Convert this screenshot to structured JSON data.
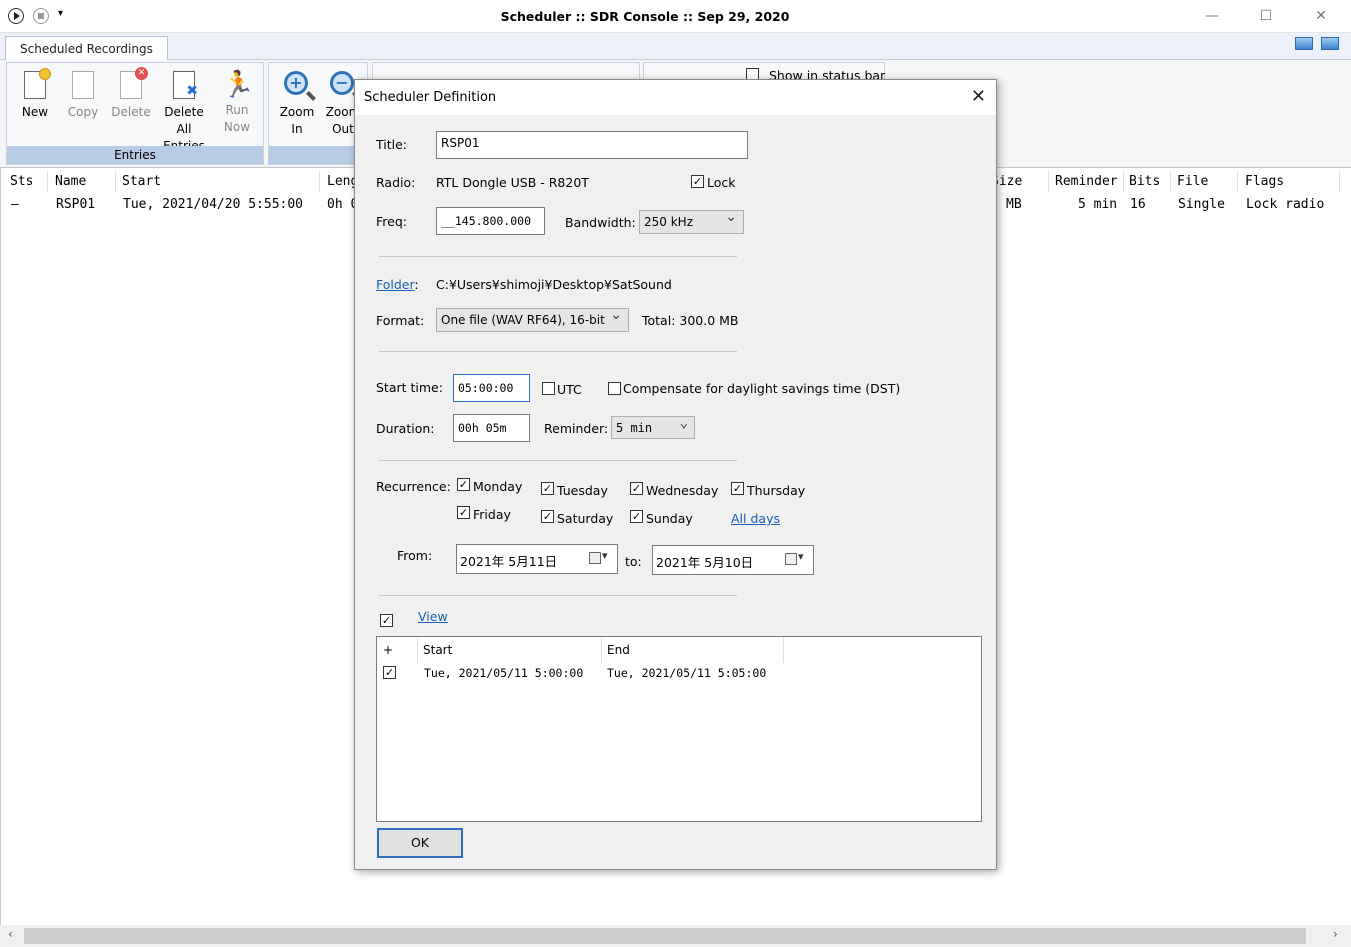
{
  "window": {
    "title": "Scheduler :: SDR Console :: Sep 29, 2020",
    "minimize": "—",
    "maximize": "☐",
    "close": "✕"
  },
  "tabs": [
    {
      "label": "Scheduled Recordings"
    }
  ],
  "ribbon": {
    "entries_group": "Entries",
    "buttons": {
      "new": [
        "New",
        ""
      ],
      "copy": [
        "Copy",
        ""
      ],
      "delete": [
        "Delete",
        ""
      ],
      "delete_all": [
        "Delete All",
        "Entries"
      ],
      "run_now": [
        "Run",
        "Now"
      ],
      "zoom_in": [
        "Zoom",
        "In"
      ],
      "zoom_out": [
        "Zoom",
        "Out"
      ]
    },
    "show_in_status_bar": "Show in status bar"
  },
  "list": {
    "columns": [
      "Sts",
      "Name",
      "Start",
      "Leng",
      "Size",
      "Reminder",
      "Bits",
      "File",
      "Flags"
    ],
    "rows": [
      {
        "sts": "—",
        "name": "RSP01",
        "start": "Tue, 2021/04/20 5:55:00",
        "length": "0h 0",
        "size": "MB",
        "reminder": "5 min",
        "bits": "16",
        "file": "Single",
        "flags": "Lock radio"
      }
    ]
  },
  "dialog": {
    "title": "Scheduler Definition",
    "close": "✕",
    "title_label": "Title:",
    "title_value": "RSP01",
    "radio_label": "Radio:",
    "radio_value": "RTL Dongle USB - R820T",
    "lock_label": "Lock",
    "lock_checked": true,
    "freq_label": "Freq:",
    "freq_value": "__145.800.000",
    "bandwidth_label": "Bandwidth:",
    "bandwidth_value": "250 kHz",
    "folder_label": "Folder",
    "folder_colon": ":",
    "folder_value": "C:¥Users¥shimoji¥Desktop¥SatSound",
    "format_label": "Format:",
    "format_value": "One file (WAV RF64), 16-bit",
    "total_label": "Total: 300.0 MB",
    "start_time_label": "Start time:",
    "start_time_value": "05:00:00",
    "utc_label": "UTC",
    "dst_label": "Compensate for daylight savings time (DST)",
    "duration_label": "Duration:",
    "duration_value": "00h 05m",
    "reminder_label": "Reminder:",
    "reminder_value": "5 min",
    "recurrence_label": "Recurrence:",
    "days": {
      "monday": "Monday",
      "tuesday": "Tuesday",
      "wednesday": "Wednesday",
      "thursday": "Thursday",
      "friday": "Friday",
      "saturday": "Saturday",
      "sunday": "Sunday"
    },
    "all_days": "All days",
    "from_label": "From:",
    "from_value": "2021年 5月11日",
    "to_label": "to:",
    "to_value": "2021年 5月10日",
    "view_label": "View",
    "occurrences": {
      "headers": [
        "+",
        "Start",
        "End"
      ],
      "rows": [
        {
          "start": "Tue, 2021/05/11 5:00:00",
          "end": "Tue, 2021/05/11 5:05:00"
        }
      ]
    },
    "ok": "OK"
  }
}
